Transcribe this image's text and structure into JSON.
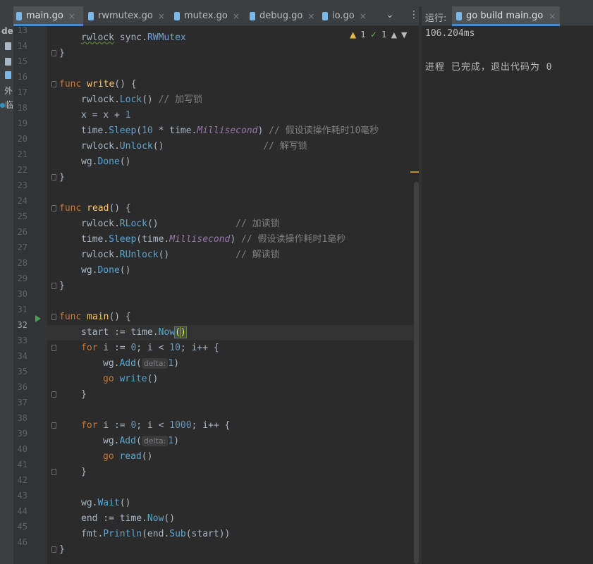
{
  "tabs": [
    {
      "label": "main.go",
      "active": true
    },
    {
      "label": "rwmutex.go",
      "active": false
    },
    {
      "label": "mutex.go",
      "active": false
    },
    {
      "label": "debug.go",
      "active": false
    },
    {
      "label": "io.go",
      "active": false
    }
  ],
  "close_glyph": "×",
  "chevron_glyph": "⌄",
  "kebab_glyph": "⋮",
  "project_strip": {
    "item_de": "de",
    "item_ext": "外",
    "item_temp": "临"
  },
  "inspections": {
    "warning_count": "1",
    "typo_count": "1"
  },
  "line_numbers": [
    "13",
    "14",
    "15",
    "16",
    "17",
    "18",
    "19",
    "20",
    "21",
    "22",
    "23",
    "24",
    "25",
    "26",
    "27",
    "28",
    "29",
    "30",
    "31",
    "32",
    "33",
    "34",
    "35",
    "36",
    "37",
    "38",
    "39",
    "40",
    "41",
    "42",
    "43",
    "44",
    "45",
    "46"
  ],
  "code": {
    "l13": {
      "a": "rwlock",
      "b": " sync.",
      "c": "RWMutex"
    },
    "l14": "}",
    "l16": {
      "kw": "func",
      "fn": " write",
      "rest": "() {"
    },
    "l17": {
      "a": "rwlock.",
      "b": "Lock",
      "c": "() ",
      "cm": "// 加写锁"
    },
    "l18": {
      "a": "x = x + ",
      "n": "1"
    },
    "l19": {
      "a": "time.",
      "b": "Sleep",
      "c": "(",
      "n": "10",
      "d": " * time.",
      "e": "Millisecond",
      "f": ") ",
      "cm": "// 假设读操作耗时10毫秒"
    },
    "l20": {
      "a": "rwlock.",
      "b": "Unlock",
      "c": "()                  ",
      "cm": "// 解写锁"
    },
    "l21": {
      "a": "wg.",
      "b": "Done",
      "c": "()"
    },
    "l22": "}",
    "l24": {
      "kw": "func",
      "fn": " read",
      "rest": "() {"
    },
    "l25": {
      "a": "rwlock.",
      "b": "RLock",
      "c": "()              ",
      "cm": "// 加读锁"
    },
    "l26": {
      "a": "time.",
      "b": "Sleep",
      "c": "(time.",
      "e": "Millisecond",
      "f": ") ",
      "cm": "// 假设读操作耗时1毫秒"
    },
    "l27": {
      "a": "rwlock.",
      "b": "RUnlock",
      "c": "()            ",
      "cm": "// 解读锁"
    },
    "l28": {
      "a": "wg.",
      "b": "Done",
      "c": "()"
    },
    "l29": "}",
    "l31": {
      "kw": "func",
      "fn": " main",
      "rest": "() {"
    },
    "l32": {
      "a": "start := time.",
      "b": "Now",
      "p1": "(",
      "p2": ")"
    },
    "l33": {
      "kw": "for",
      "a": " i := ",
      "n1": "0",
      "b": "; i < ",
      "n2": "10",
      "c": "; i++ {"
    },
    "l34": {
      "a": "wg.",
      "b": "Add",
      "c": "(",
      "hint": "delta:",
      "n": "1",
      "d": ")"
    },
    "l35": {
      "kw": "go",
      "b": " write",
      "c": "()"
    },
    "l36": "}",
    "l38": {
      "kw": "for",
      "a": " i := ",
      "n1": "0",
      "b": "; i < ",
      "n2": "1000",
      "c": "; i++ {"
    },
    "l39": {
      "a": "wg.",
      "b": "Add",
      "c": "(",
      "hint": "delta:",
      "n": "1",
      "d": ")"
    },
    "l40": {
      "kw": "go",
      "b": " read",
      "c": "()"
    },
    "l41": "}",
    "l43": {
      "a": "wg.",
      "b": "Wait",
      "c": "()"
    },
    "l44": {
      "a": "end := time.",
      "b": "Now",
      "c": "()"
    },
    "l45": {
      "a": "fmt.",
      "b": "Println",
      "c": "(end.",
      "d": "Sub",
      "e": "(start))"
    },
    "l46": "}"
  },
  "run_panel": {
    "label": "运行:",
    "tab_label": "go build main.go",
    "output_line1": "106.204ms",
    "output_line2": "进程 已完成，退出代码为 0"
  },
  "colors": {
    "keyword": "#cc7832",
    "function": "#ffc66d",
    "number": "#6897bb",
    "comment": "#808080",
    "accent": "#4a88c7"
  }
}
